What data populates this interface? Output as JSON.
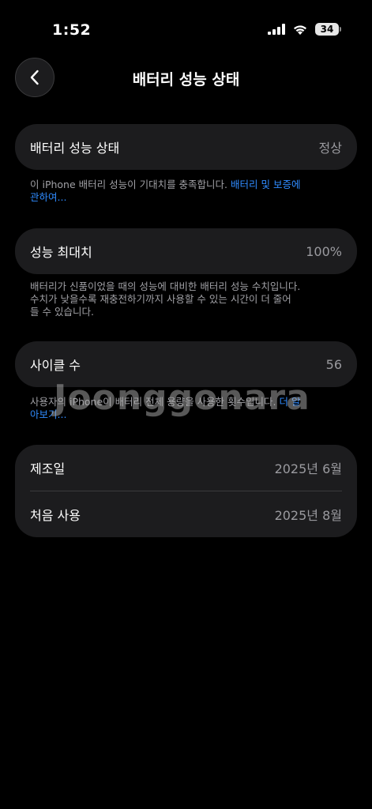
{
  "status_bar": {
    "time": "1:52",
    "battery_level": "34"
  },
  "nav": {
    "title": "배터리 성능 상태"
  },
  "battery_health": {
    "label": "배터리 성능 상태",
    "value": "정상",
    "note": "이 iPhone 배터리 성능이 기대치를 충족합니다.",
    "link_line1": "배터리 및 보증에",
    "link_line2": "관하여..."
  },
  "max_capacity": {
    "label": "성능 최대치",
    "value": "100%",
    "note_line1": "배터리가 신품이었을 때의 성능에 대비한 배터리 성능 수치입니다.",
    "note_line2": "수치가 낮을수록 재충전하기까지 사용할 수 있는 시간이 더 줄어",
    "note_line3": "들 수 있습니다."
  },
  "cycle_count": {
    "label": "사이클 수",
    "value": "56",
    "note": "사용자의 iPhone이 배터리 전체 용량을 사용한 횟수입니다.",
    "link_line1": "더 알",
    "link_line2": "아보기..."
  },
  "dates": {
    "manufacture_label": "제조일",
    "manufacture_value": "2025년 6월",
    "first_use_label": "처음 사용",
    "first_use_value": "2025년 8월"
  },
  "watermark": "Joonggonara",
  "colors": {
    "background": "#000000",
    "card": "#1c1c1e",
    "link": "#2f8bff",
    "secondary_text": "#9a9a9f"
  }
}
